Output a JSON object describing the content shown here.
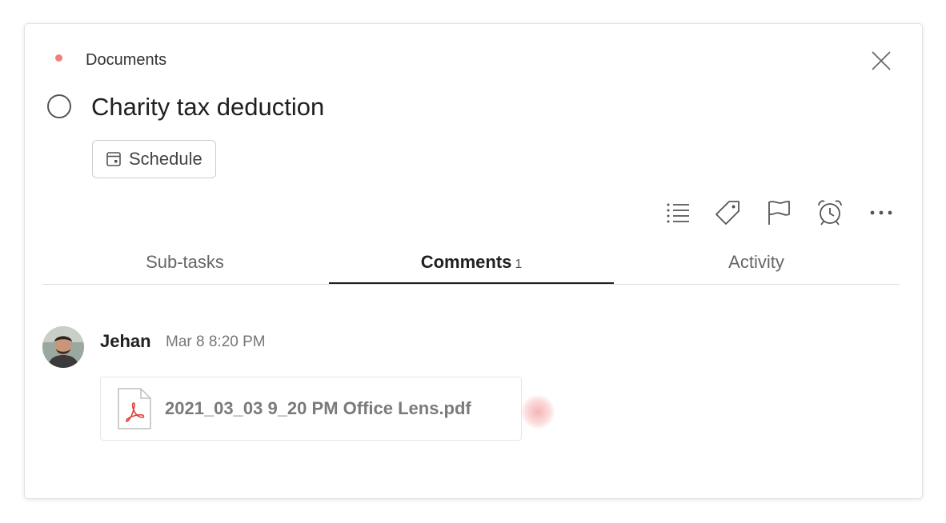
{
  "project": {
    "name": "Documents",
    "color": "#f08080"
  },
  "task": {
    "title": "Charity tax deduction",
    "schedule_label": "Schedule"
  },
  "toolbar": {
    "icons": [
      "list-icon",
      "tag-icon",
      "flag-icon",
      "alarm-clock-icon",
      "more-icon"
    ]
  },
  "tabs": [
    {
      "label": "Sub-tasks"
    },
    {
      "label": "Comments",
      "count": "1"
    },
    {
      "label": "Activity"
    }
  ],
  "comment": {
    "author": "Jehan",
    "timestamp": "Mar 8 8:20 PM",
    "attachment": {
      "file_name": "2021_03_03 9_20 PM Office Lens.pdf",
      "icon": "pdf-file-icon"
    }
  },
  "colors": {
    "accent": "#f08080",
    "pdf_red": "#e0403a"
  }
}
